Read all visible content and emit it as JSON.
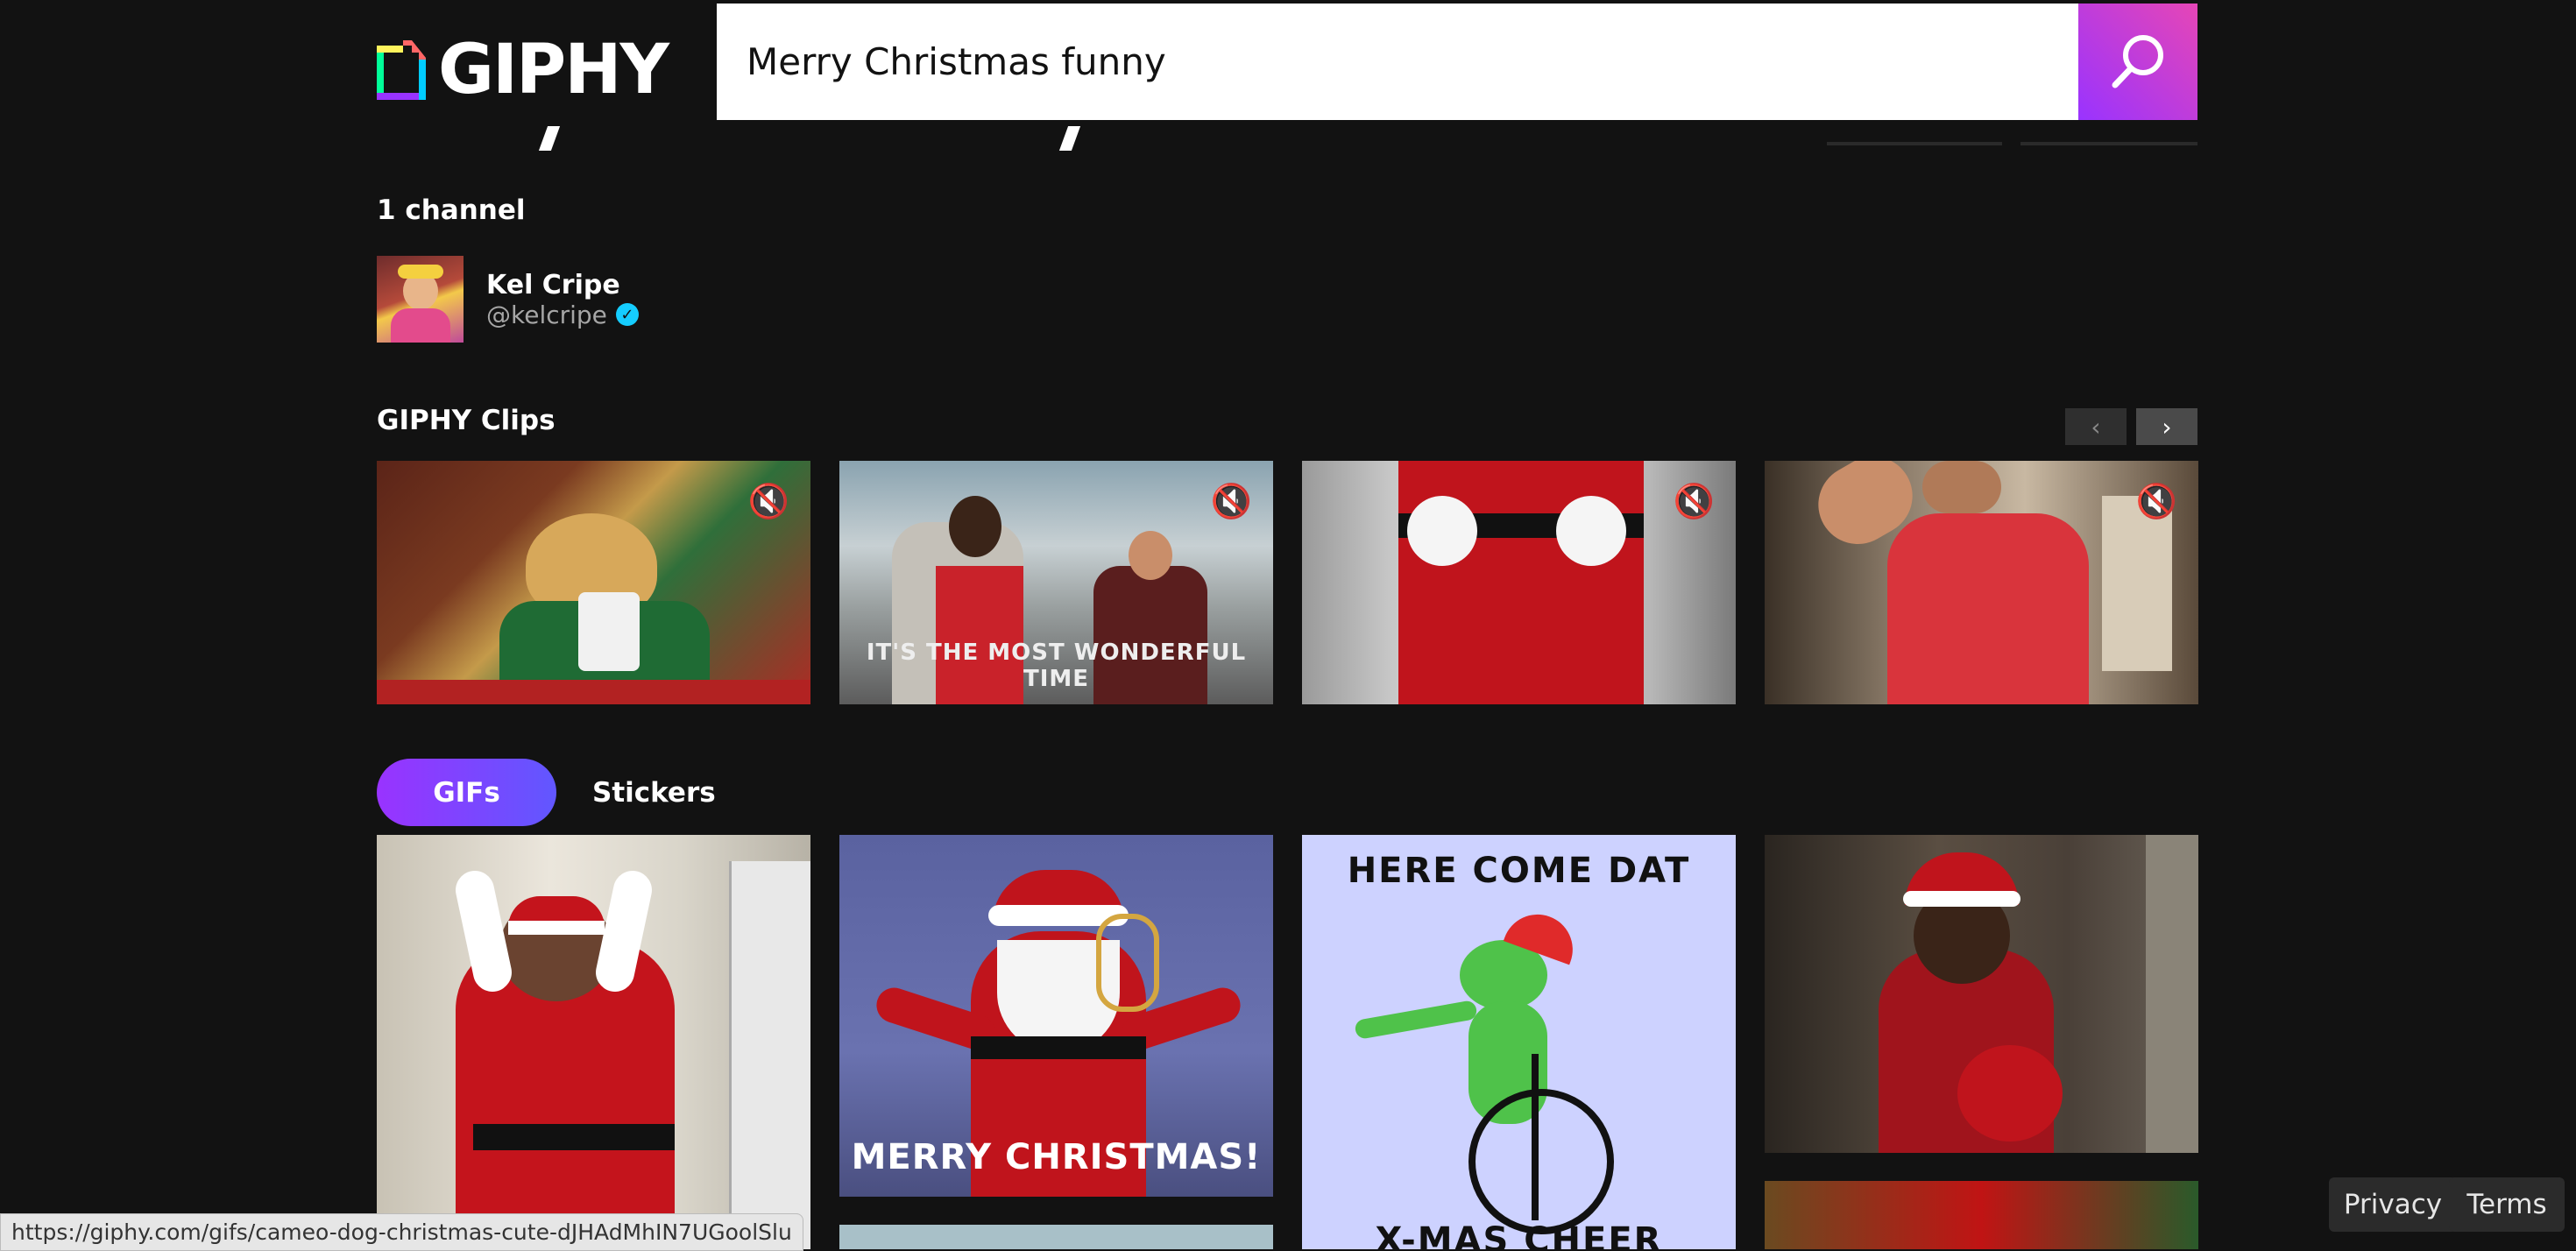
{
  "header": {
    "logo_text": "GIPHY",
    "search_value": "Merry Christmas funny",
    "search_icon": "search-icon"
  },
  "channels": {
    "heading": "1 channel",
    "items": [
      {
        "name": "Kel Cripe",
        "handle": "@kelcripe",
        "verified": true
      }
    ]
  },
  "clips": {
    "heading": "GIPHY Clips",
    "items": [
      {
        "caption": "",
        "muted": true
      },
      {
        "caption": "IT'S THE MOST WONDERFUL TIME",
        "muted": true
      },
      {
        "caption": "",
        "muted": true
      },
      {
        "caption": "",
        "muted": true
      }
    ]
  },
  "tabs": [
    {
      "label": "GIFs",
      "active": true
    },
    {
      "label": "Stickers",
      "active": false
    }
  ],
  "gifs": {
    "captions": [
      "MERRY CHRISTMAS!",
      "HERE COME DAT",
      "X-MAS CHEER"
    ]
  },
  "status_url": "https://giphy.com/gifs/cameo-dog-christmas-cute-dJHAdMhIN7UGoolSlu",
  "footer": {
    "privacy": "Privacy",
    "terms": "Terms"
  },
  "colors": {
    "background": "#121212",
    "accent_purple": "#9933ff",
    "accent_pink": "#e646b6",
    "verified_blue": "#15cdff"
  }
}
